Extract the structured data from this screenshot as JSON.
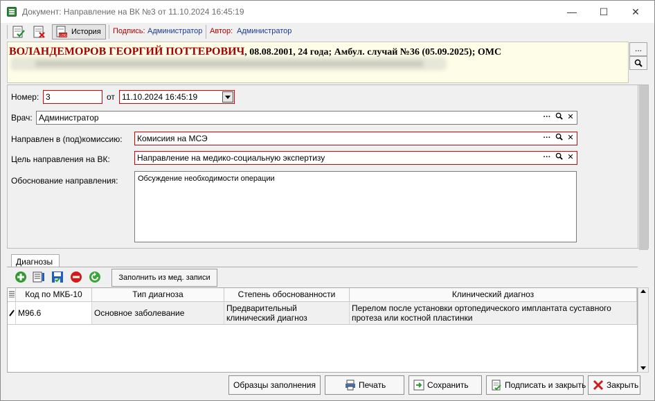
{
  "window": {
    "title": "Документ: Направление на ВК №3 от 11.10.2024 16:45:19",
    "controls": {
      "minimize": "—",
      "maximize": "☐",
      "close": "✕"
    }
  },
  "toolbar": {
    "history_label": "История",
    "sign_label": "Подпись:",
    "sign_value": "Администратор",
    "author_label": "Автор:",
    "author_value": "Администратор"
  },
  "patient": {
    "name": "ВОЛАНДЕМОРОВ ГЕОРГИЙ ПОТТЕРОВИЧ",
    "info": ", 08.08.2001, 24 года; Амбул. случай №36 (05.09.2025); ОМС",
    "side_btn_more": "...",
    "side_btn_search": "🔍"
  },
  "form": {
    "number_label": "Номер:",
    "number_value": "3",
    "date_label": "от",
    "date_value": "11.10.2024 16:45:19",
    "doctor_label": "Врач:",
    "doctor_value": "Администратор",
    "commission_label": "Направлен в (под)комиссию:",
    "commission_value": "Комисиия на МСЭ",
    "purpose_label": "Цель направления на ВК:",
    "purpose_value": "Направление на медико-социальную экспертизу",
    "reason_label": "Обоснование направления:",
    "reason_value": "Обсуждение необходимости операции",
    "field_icons": {
      "more": "···",
      "search": "🔍",
      "clear": "✕"
    }
  },
  "diagnoses": {
    "tab_label": "Диагнозы",
    "fill_button": "Заполнить из мед. записи",
    "columns": [
      "Код по МКБ-10",
      "Тип диагноза",
      "Степень обоснованности",
      "Клинический диагноз"
    ],
    "rows": [
      {
        "code": "M96.6",
        "type": "Основное заболевание",
        "degree": "Предварительный клинический диагноз",
        "clinical": "Перелом после установки ортопедического имплантата суставного протеза или костной пластинки"
      }
    ]
  },
  "bottom": {
    "samples": "Образцы заполнения",
    "print": "Печать",
    "save": "Сохранить",
    "sign_close": "Подписать и закрыть",
    "close": "Закрыть"
  },
  "colors": {
    "required_border": "#d80000",
    "patient_bg": "#fefee8",
    "name_color": "#a40000"
  }
}
